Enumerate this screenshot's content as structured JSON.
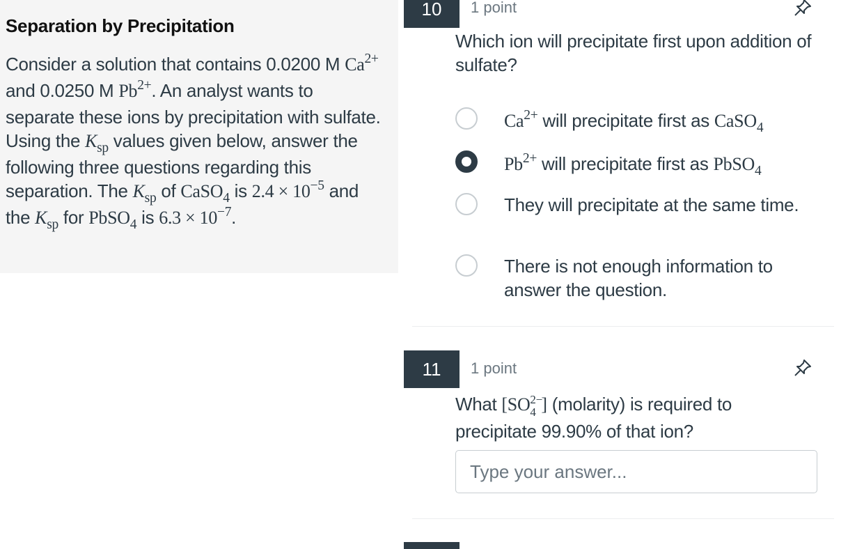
{
  "passage": {
    "title": "Separation by Precipitation",
    "text_1": "Consider a solution that contains 0.0200 M ",
    "ca": "Ca",
    "charge_2plus": "2+",
    "text_2": " and 0.0250 M ",
    "pb": "Pb",
    "text_3": ". An analyst wants to separate these ions by precipitation with sulfate. Using the ",
    "ksp_k": "K",
    "ksp_sp": "sp",
    "text_4": " values given below, answer the following three questions regarding this separation. The ",
    "text_5": " of ",
    "caso4": "CaSO",
    "four": "4",
    "text_6": " is ",
    "caso4_val": "2.4 × 10",
    "caso4_exp": "−5",
    "text_7": " and the ",
    "text_8": " for ",
    "pbso4": "PbSO",
    "text_9": " is ",
    "pbso4_val": "6.3 × 10",
    "pbso4_exp": "−7",
    "text_10": "."
  },
  "q10": {
    "number": "10",
    "points": "1 point",
    "text": "Which ion will precipitate first upon addition of sulfate?",
    "options": [
      {
        "ion": "Ca",
        "charge": "2+",
        "mid": " will precipitate first as ",
        "salt": "CaSO",
        "sub": "4",
        "selected": false
      },
      {
        "ion": "Pb",
        "charge": "2+",
        "mid": " will precipitate first as ",
        "salt": "PbSO",
        "sub": "4",
        "selected": true
      },
      {
        "text": "They will precipitate at the same time.",
        "selected": false
      },
      {
        "text": "There is not enough information to answer the question.",
        "selected": false
      }
    ]
  },
  "q11": {
    "number": "11",
    "points": "1 point",
    "text_before": "What ",
    "species": "[SO",
    "species_sub": "4",
    "species_sup": "2−",
    "species_close": "]",
    "text_after": " (molarity) is required to precipitate 99.90% of that ion?",
    "input_placeholder": "Type your answer..."
  },
  "icons": {
    "pin": "pin-icon"
  },
  "colors": {
    "dark": "#2d3b45",
    "panel": "#f5f5f5",
    "border": "#c7cdd1"
  }
}
